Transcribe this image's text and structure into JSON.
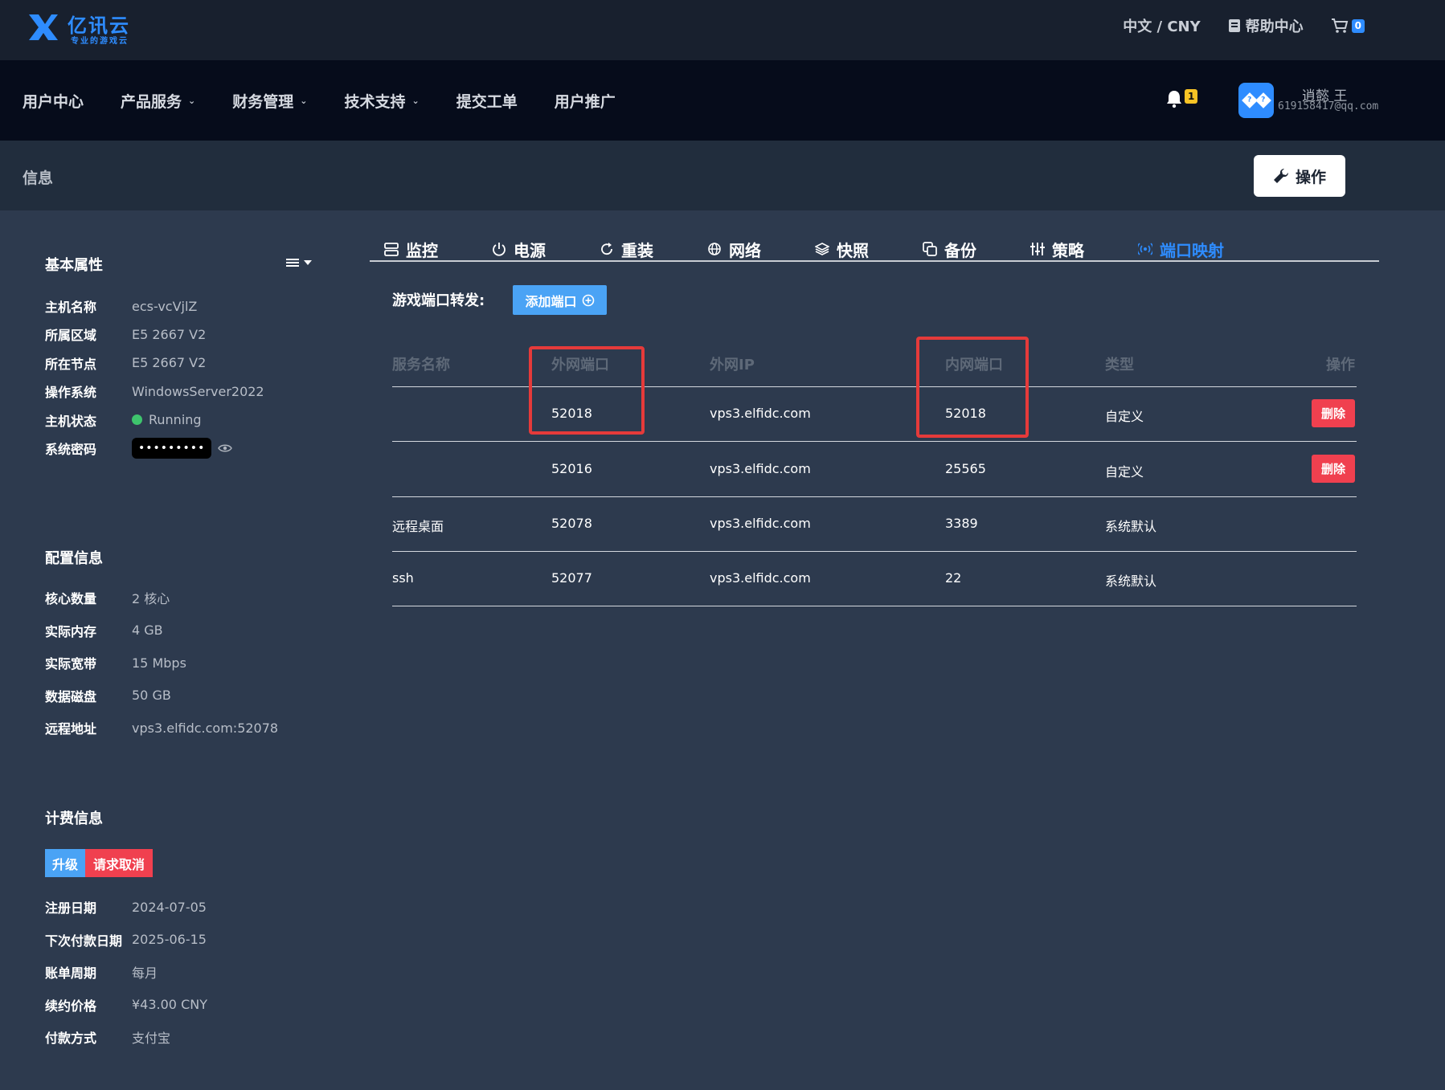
{
  "header": {
    "logo_text": "亿讯云",
    "logo_sub": "专业的游戏云",
    "language": "中文 / CNY",
    "help": "帮助中心",
    "cart_count": "0"
  },
  "nav": {
    "items": [
      {
        "label": "用户中心",
        "dropdown": false
      },
      {
        "label": "产品服务",
        "dropdown": true
      },
      {
        "label": "财务管理",
        "dropdown": true
      },
      {
        "label": "技术支持",
        "dropdown": true
      },
      {
        "label": "提交工单",
        "dropdown": false
      },
      {
        "label": "用户推广",
        "dropdown": false
      }
    ],
    "notifications": "1",
    "user_name": "逍懿 王",
    "user_email": "619158417@qq.com"
  },
  "subheader": {
    "title": "信息",
    "action_label": "操作"
  },
  "basic": {
    "title": "基本属性",
    "rows": [
      {
        "label": "主机名称",
        "value": "ecs-vcVjlZ"
      },
      {
        "label": "所属区域",
        "value": "E5 2667 V2"
      },
      {
        "label": "所在节点",
        "value": "E5 2667 V2"
      },
      {
        "label": "操作系统",
        "value": "WindowsServer2022"
      },
      {
        "label": "主机状态",
        "value": "Running"
      },
      {
        "label": "系统密码",
        "value": "•••••••••"
      }
    ]
  },
  "config": {
    "title": "配置信息",
    "rows": [
      {
        "label": "核心数量",
        "value": "2 核心"
      },
      {
        "label": "实际内存",
        "value": "4 GB"
      },
      {
        "label": "实际宽带",
        "value": "15 Mbps"
      },
      {
        "label": "数据磁盘",
        "value": "50 GB"
      },
      {
        "label": "远程地址",
        "value": "vps3.elfidc.com:52078"
      }
    ]
  },
  "billing": {
    "title": "计费信息",
    "upgrade_label": "升级",
    "cancel_label": "请求取消",
    "rows": [
      {
        "label": "注册日期",
        "value": "2024-07-05"
      },
      {
        "label": "下次付款日期",
        "value": "2025-06-15"
      },
      {
        "label": "账单周期",
        "value": "每月"
      },
      {
        "label": "续约价格",
        "value": "¥43.00 CNY"
      },
      {
        "label": "付款方式",
        "value": "支付宝"
      }
    ]
  },
  "tabs": [
    {
      "label": "监控",
      "icon": "server-icon",
      "active": false
    },
    {
      "label": "电源",
      "icon": "power-icon",
      "active": false
    },
    {
      "label": "重装",
      "icon": "refresh-icon",
      "active": false
    },
    {
      "label": "网络",
      "icon": "globe-icon",
      "active": false
    },
    {
      "label": "快照",
      "icon": "layers-icon",
      "active": false
    },
    {
      "label": "备份",
      "icon": "copy-icon",
      "active": false
    },
    {
      "label": "策略",
      "icon": "sliders-icon",
      "active": false
    },
    {
      "label": "端口映射",
      "icon": "broadcast-icon",
      "active": true
    }
  ],
  "port_forward": {
    "title": "游戏端口转发:",
    "add_label": "添加端口",
    "columns": [
      "服务名称",
      "外网端口",
      "外网IP",
      "内网端口",
      "类型",
      "操作"
    ],
    "rows": [
      {
        "service": "",
        "ext_port": "52018",
        "ext_ip": "vps3.elfidc.com",
        "int_port": "52018",
        "type": "自定义",
        "action": "删除"
      },
      {
        "service": "",
        "ext_port": "52016",
        "ext_ip": "vps3.elfidc.com",
        "int_port": "25565",
        "type": "自定义",
        "action": "删除"
      },
      {
        "service": "远程桌面",
        "ext_port": "52078",
        "ext_ip": "vps3.elfidc.com",
        "int_port": "3389",
        "type": "系统默认",
        "action": ""
      },
      {
        "service": "ssh",
        "ext_port": "52077",
        "ext_ip": "vps3.elfidc.com",
        "int_port": "22",
        "type": "系统默认",
        "action": ""
      }
    ]
  },
  "colors": {
    "accent": "#2e8cff",
    "danger": "#f0404f",
    "status_running": "#3ec46d",
    "highlight_box": "#e53a3a"
  }
}
